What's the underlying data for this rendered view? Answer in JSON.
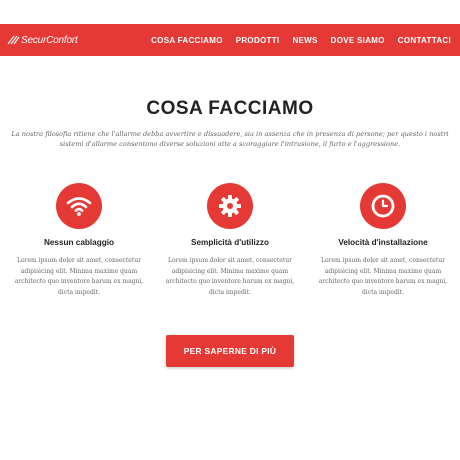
{
  "brand": {
    "name": "SecurConfort"
  },
  "nav": {
    "items": [
      {
        "label": "COSA FACCIAMO"
      },
      {
        "label": "PRODOTTI"
      },
      {
        "label": "NEWS"
      },
      {
        "label": "DOVE SIAMO"
      },
      {
        "label": "CONTATTACI"
      }
    ]
  },
  "section": {
    "title": "COSA FACCIAMO",
    "intro": "La nostra filosofia ritiene che l'allarme debba avvertire e dissuadere, sia in assenza che in presenza di persone; per questo i nostri sistemi d'allarme consentono diverse soluzioni atte a scoraggiare l'intrusione, il furto e l'aggressione."
  },
  "features": [
    {
      "icon": "wifi-icon",
      "title": "Nessun cablaggio",
      "text": "Lorem ipsum dolor sit amet, consectetur adipisicing elit. Minima maxime quam architecto quo inventore harum ex magni, dicta impedit."
    },
    {
      "icon": "gear-icon",
      "title": "Semplicità d'utilizzo",
      "text": "Lorem ipsum dolor sit amet, consectetur adipisicing elit. Minima maxime quam architecto quo inventore harum ex magni, dicta impedit."
    },
    {
      "icon": "clock-icon",
      "title": "Velocità d'installazione",
      "text": "Lorem ipsum dolor sit amet, consectetur adipisicing elit. Minima maxime quam architecto quo inventore harum ex magni, dicta impedit."
    }
  ],
  "cta": {
    "label": "PER SAPERNE DI PIÙ"
  },
  "colors": {
    "accent": "#e53935",
    "title": "#222222",
    "body": "#666666"
  }
}
